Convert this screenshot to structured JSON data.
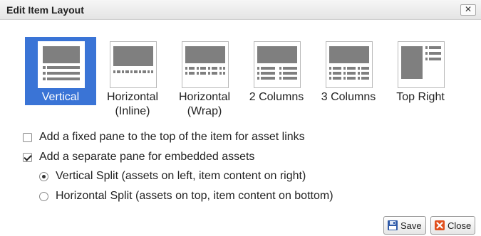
{
  "dialog": {
    "title": "Edit Item Layout",
    "close_glyph": "✕"
  },
  "layouts": [
    {
      "label_line1": "Vertical",
      "label_line2": "",
      "selected": true,
      "icon": "vertical-layout-icon"
    },
    {
      "label_line1": "Horizontal",
      "label_line2": "(Inline)",
      "selected": false,
      "icon": "horizontal-inline-layout-icon"
    },
    {
      "label_line1": "Horizontal",
      "label_line2": "(Wrap)",
      "selected": false,
      "icon": "horizontal-wrap-layout-icon"
    },
    {
      "label_line1": "2 Columns",
      "label_line2": "",
      "selected": false,
      "icon": "two-columns-layout-icon"
    },
    {
      "label_line1": "3 Columns",
      "label_line2": "",
      "selected": false,
      "icon": "three-columns-layout-icon"
    },
    {
      "label_line1": "Top Right",
      "label_line2": "",
      "selected": false,
      "icon": "top-right-layout-icon"
    }
  ],
  "options": {
    "fixed_pane": {
      "label": "Add a fixed pane to the top of the item for asset links",
      "checked": false
    },
    "separate_pane": {
      "label": "Add a separate pane for embedded assets",
      "checked": true
    },
    "vertical_split": {
      "label": "Vertical Split (assets on left, item content on right)",
      "checked": true
    },
    "horizontal_split": {
      "label": "Horizontal Split (assets on top, item content on bottom)",
      "checked": false
    }
  },
  "buttons": {
    "save_label": "Save",
    "close_label": "Close"
  },
  "colors": {
    "selected_bg": "#3a74d6",
    "thumb_fill": "#7f7f7f"
  }
}
